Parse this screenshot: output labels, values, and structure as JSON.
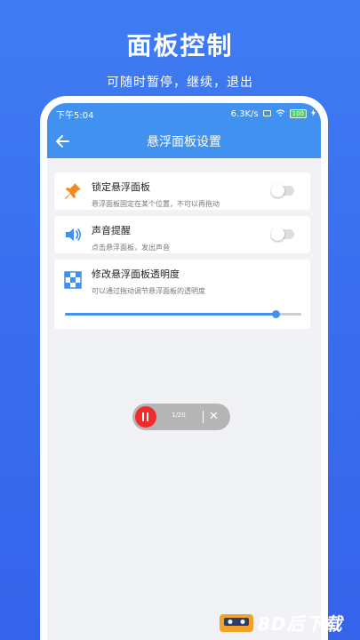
{
  "hero": {
    "title": "面板控制",
    "subtitle": "可随时暂停，继续，退出"
  },
  "statusbar": {
    "time": "下午5:04",
    "net_speed": "6.3K/s",
    "battery": "100"
  },
  "appbar": {
    "title": "悬浮面板设置",
    "back_icon": "arrow-left-icon"
  },
  "settings": [
    {
      "icon": "pin-icon",
      "title": "锁定悬浮面板",
      "desc": "悬浮面板固定在某个位置，不可以再拖动",
      "toggle_on": false
    },
    {
      "icon": "speaker-icon",
      "title": "声音提醒",
      "desc": "点击悬浮面板，发出声音",
      "toggle_on": false
    },
    {
      "icon": "opacity-icon",
      "title": "修改悬浮面板透明度",
      "desc": "可以通过拖动调节悬浮面板的透明度",
      "slider_value": 0.89
    }
  ],
  "float_panel": {
    "counter": "1/20",
    "pause_icon": "pause-icon",
    "close_icon": "close-icon"
  },
  "watermark": {
    "text": "8D后下载"
  },
  "colors": {
    "background": "#3a6fef",
    "accent": "#4191f0",
    "pause_red": "#f12b2b",
    "pin_orange": "#f08a1c"
  }
}
